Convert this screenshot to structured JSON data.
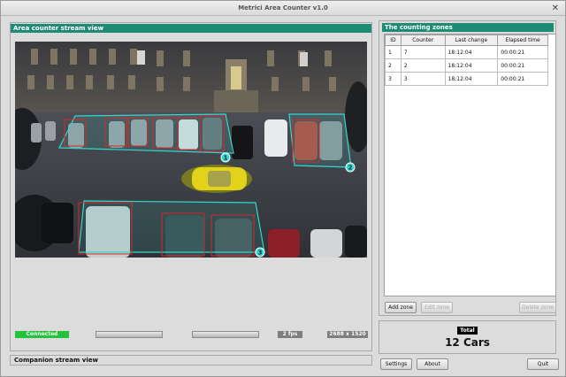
{
  "window": {
    "title": "Metrici Area Counter v1.0",
    "close_glyph": "✕"
  },
  "stream_panel": {
    "title": "Area counter stream view"
  },
  "zone_markers": [
    "1",
    "2",
    "3"
  ],
  "status": {
    "connection": "Connected",
    "fps": "2 fps",
    "resolution": "2688 x 1520"
  },
  "companion": {
    "title": "Companion stream view"
  },
  "zones_panel": {
    "title": "The counting zones",
    "columns": [
      "ID",
      "Counter",
      "Last change",
      "Elapsed time"
    ],
    "rows": [
      [
        "1",
        "7",
        "18:12:04",
        "00:00:21"
      ],
      [
        "2",
        "2",
        "18:12:04",
        "00:00:21"
      ],
      [
        "3",
        "3",
        "18:12:04",
        "00:00:21"
      ]
    ],
    "buttons": {
      "add": "Add zone",
      "edit": "Edit zone",
      "delete": "Delete zone"
    }
  },
  "total": {
    "label": "Total",
    "value": "12 Cars"
  },
  "footer": {
    "settings": "Settings",
    "about": "About",
    "quit": "Quit"
  },
  "colors": {
    "accent": "#1e8b73",
    "zone_outline": "#35d6cf",
    "car_box": "#d32a2a",
    "connected": "#22c33a"
  }
}
